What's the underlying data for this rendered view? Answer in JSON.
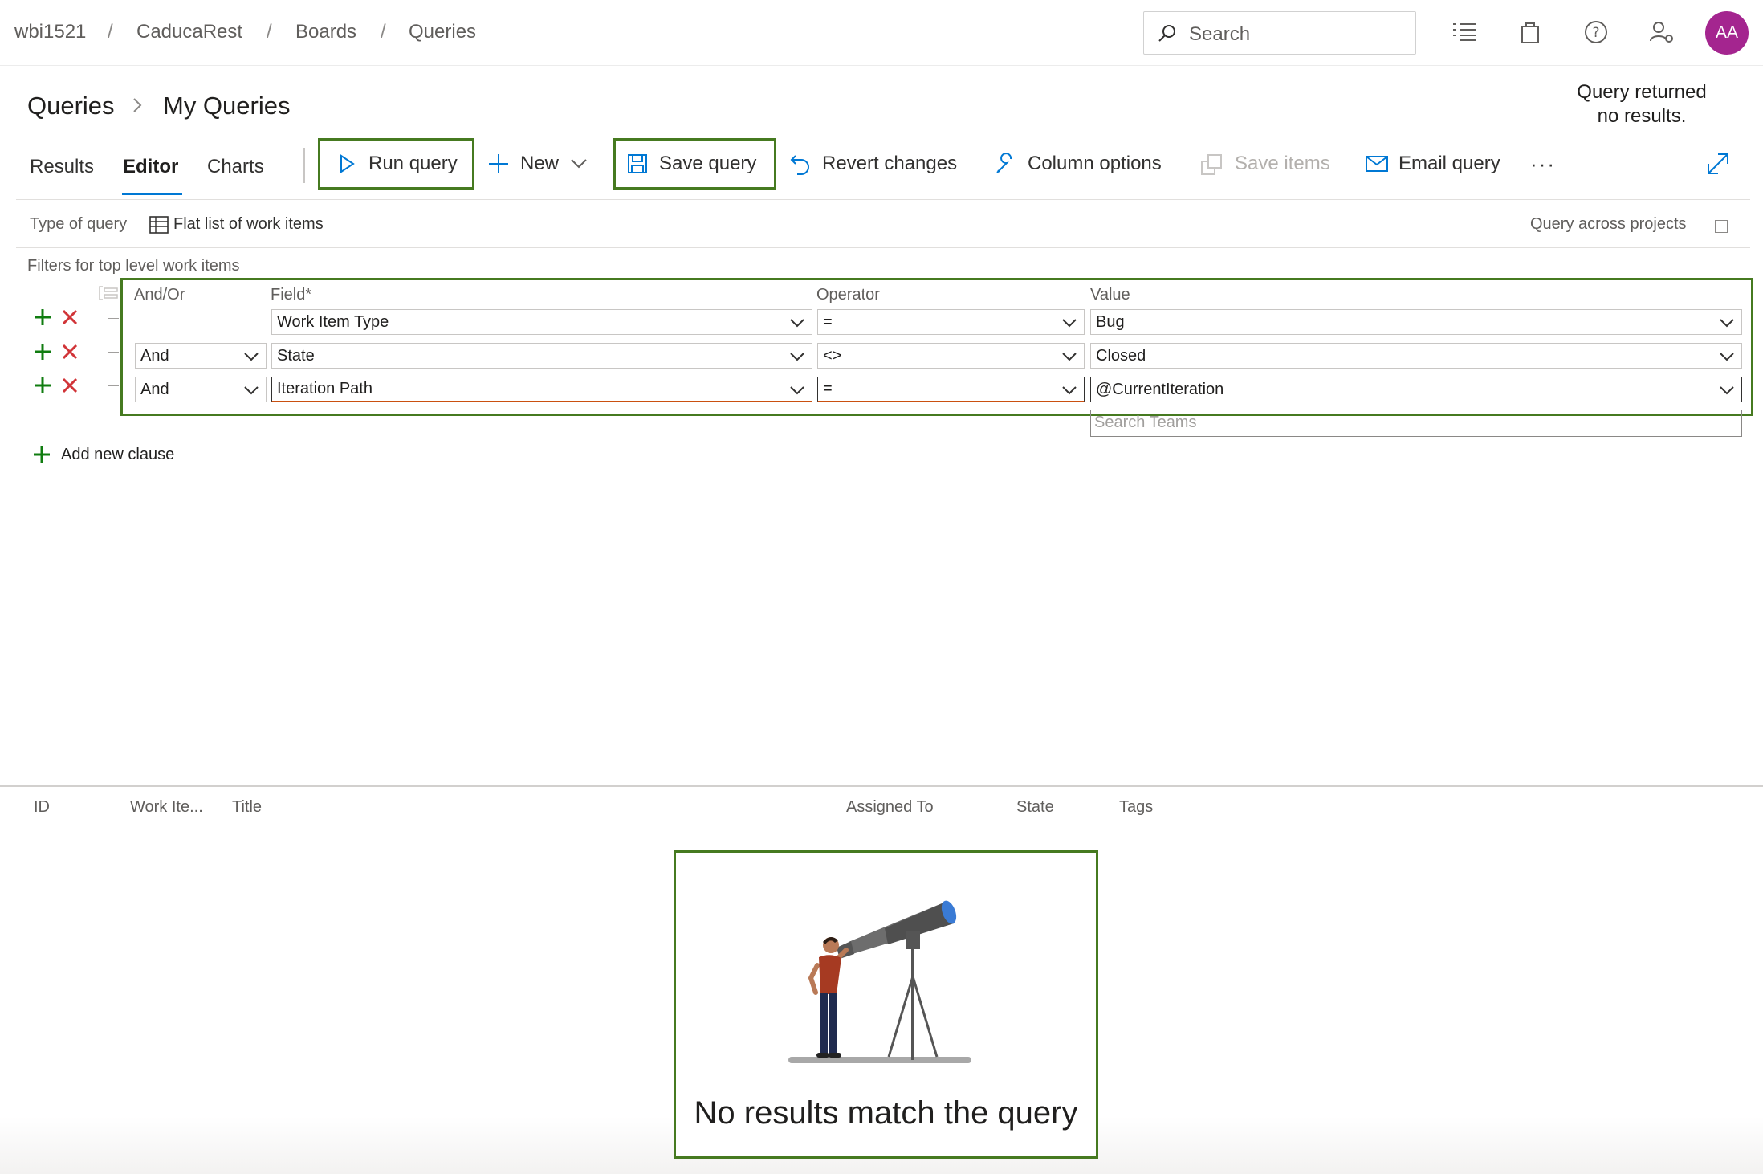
{
  "breadcrumb": {
    "org": "wbi1521",
    "project": "CaducaRest",
    "section": "Boards",
    "page": "Queries",
    "separator": "/"
  },
  "search": {
    "placeholder": "Search"
  },
  "user": {
    "initials": "AA",
    "avatar_color": "#a4258f"
  },
  "header": {
    "root": "Queries",
    "folder": "My Queries",
    "status_line1": "Query returned",
    "status_line2": "no results."
  },
  "tabs": [
    {
      "label": "Results"
    },
    {
      "label": "Editor",
      "active": true
    },
    {
      "label": "Charts"
    }
  ],
  "toolbar": {
    "run_query": "Run query",
    "new": "New",
    "save_query": "Save query",
    "revert_changes": "Revert changes",
    "column_options": "Column options",
    "save_items": "Save items",
    "email_query": "Email query",
    "more": "···"
  },
  "query_type": {
    "label": "Type of query",
    "value": "Flat list of work items",
    "across_projects": "Query across projects"
  },
  "filters": {
    "section_label": "Filters for top level work items",
    "headers": {
      "and_or": "And/Or",
      "field": "Field*",
      "operator": "Operator",
      "value": "Value"
    },
    "rows": [
      {
        "and_or": "",
        "field": "Work Item Type",
        "operator": "=",
        "value": "Bug"
      },
      {
        "and_or": "And",
        "field": "State",
        "operator": "<>",
        "value": "Closed"
      },
      {
        "and_or": "And",
        "field": "Iteration Path",
        "operator": "=",
        "value": "@CurrentIteration"
      }
    ],
    "search_teams_placeholder": "Search Teams",
    "add_clause": "Add new clause"
  },
  "results": {
    "columns": [
      "ID",
      "Work Ite...",
      "Title",
      "Assigned To",
      "State",
      "Tags"
    ],
    "empty_message": "No results match the query"
  },
  "colors": {
    "accent": "#0078d4",
    "highlight_border": "#467a20",
    "add_green": "#107c10",
    "remove_red": "#d13438"
  }
}
